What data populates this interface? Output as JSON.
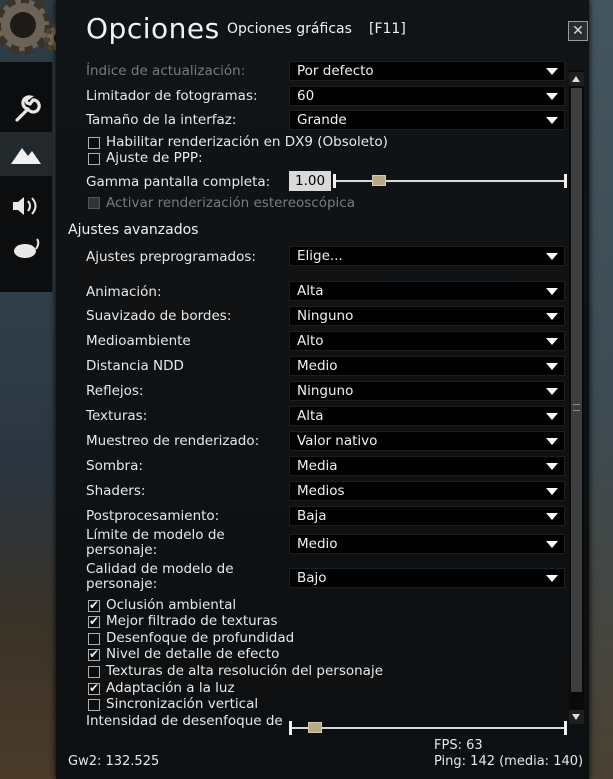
{
  "window": {
    "title": "Opciones",
    "subtitle": "Opciones gráficas",
    "hotkey": "[F11]",
    "close": "✕"
  },
  "sidebar": [
    {
      "icon": "wrench-icon",
      "active": false
    },
    {
      "icon": "mountains-icon",
      "active": true
    },
    {
      "icon": "speaker-icon",
      "active": false
    },
    {
      "icon": "mouse-icon",
      "active": false
    }
  ],
  "top_settings": {
    "refresh_rate": {
      "label": "Índice de actualización:",
      "value": "Por defecto"
    },
    "frame_limiter": {
      "label": "Limitador de fotogramas:",
      "value": "60"
    },
    "interface_size": {
      "label": "Tamaño de la interfaz:",
      "value": "Grande"
    },
    "dx9": {
      "label": "Habilitar renderización en DX9 (Obsoleto)",
      "checked": false
    },
    "dpi": {
      "label": "Ajuste de PPP:",
      "checked": false
    },
    "gamma": {
      "label": "Gamma pantalla completa:",
      "value": "1.00"
    },
    "stereo": {
      "label": "Activar renderización estereoscópica",
      "checked": false
    }
  },
  "advanced": {
    "heading": "Ajustes avanzados",
    "preset": {
      "label": "Ajustes preprogramados:",
      "value": "Elige..."
    },
    "animation": {
      "label": "Animación:",
      "value": "Alta"
    },
    "antialias": {
      "label": "Suavizado de bordes:",
      "value": "Ninguno"
    },
    "environment": {
      "label": "Medioambiente",
      "value": "Alto"
    },
    "lod": {
      "label": "Distancia NDD",
      "value": "Medio"
    },
    "reflections": {
      "label": "Reflejos:",
      "value": "Ninguno"
    },
    "textures": {
      "label": "Texturas:",
      "value": "Alta"
    },
    "sampling": {
      "label": "Muestreo de renderizado:",
      "value": "Valor nativo"
    },
    "shadows": {
      "label": "Sombra:",
      "value": "Media"
    },
    "shaders": {
      "label": "Shaders:",
      "value": "Medios"
    },
    "postprocessing": {
      "label": "Postprocesamiento:",
      "value": "Baja"
    },
    "char_limit": {
      "label": "Límite de modelo de personaje:",
      "value": "Medio"
    },
    "char_quality": {
      "label": "Calidad de modelo de personaje:",
      "value": "Bajo"
    }
  },
  "checkboxes": [
    {
      "label": "Oclusión ambiental",
      "checked": true
    },
    {
      "label": "Mejor filtrado de texturas",
      "checked": true
    },
    {
      "label": "Desenfoque de profundidad",
      "checked": false
    },
    {
      "label": "Nivel de detalle de efecto",
      "checked": true
    },
    {
      "label": "Texturas de alta resolución del personaje",
      "checked": false
    },
    {
      "label": "Adaptación a la luz",
      "checked": true
    },
    {
      "label": "Sincronización vertical",
      "checked": false
    }
  ],
  "blur": {
    "label": "Intensidad de desenfoque de"
  },
  "footer": {
    "build": "Gw2: 132.525",
    "fps": "FPS: 63",
    "ping": "Ping: 142 (media: 140)"
  }
}
